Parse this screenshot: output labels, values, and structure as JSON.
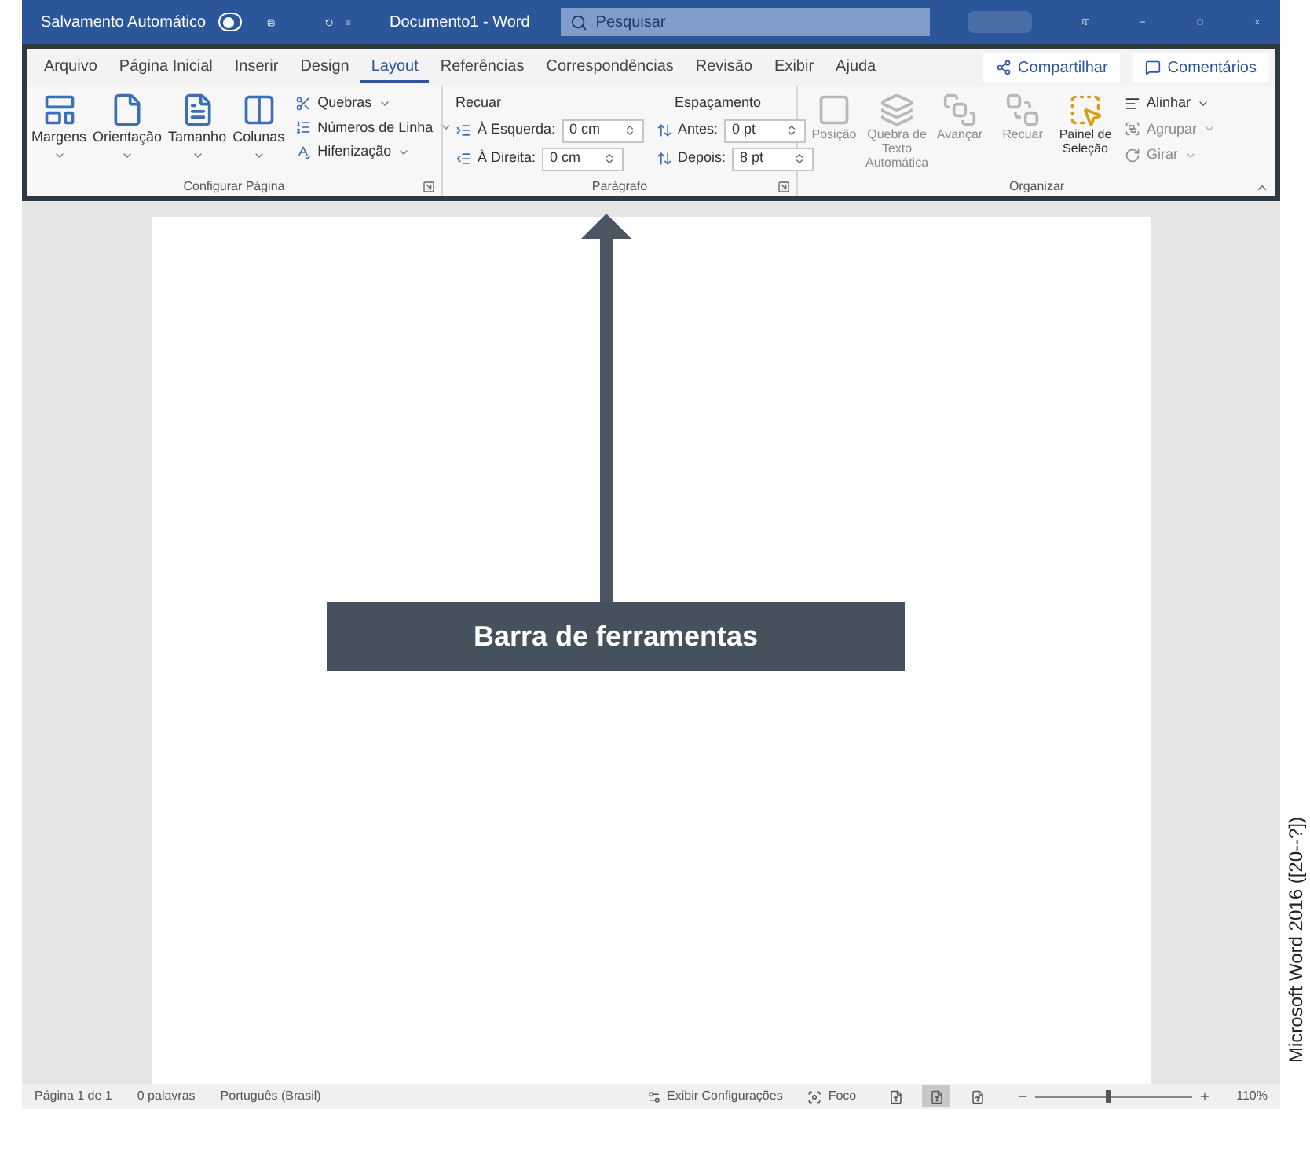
{
  "title_bar": {
    "autosave_label": "Salvamento Automático",
    "autosave_on": false,
    "document_title": "Documento1 - Word",
    "search_placeholder": "Pesquisar"
  },
  "ribbon_tabs": [
    {
      "label": "Arquivo",
      "selected": false
    },
    {
      "label": "Página Inicial",
      "selected": false
    },
    {
      "label": "Inserir",
      "selected": false
    },
    {
      "label": "Design",
      "selected": false
    },
    {
      "label": "Layout",
      "selected": true
    },
    {
      "label": "Referências",
      "selected": false
    },
    {
      "label": "Correspondências",
      "selected": false
    },
    {
      "label": "Revisão",
      "selected": false
    },
    {
      "label": "Exibir",
      "selected": false
    },
    {
      "label": "Ajuda",
      "selected": false
    }
  ],
  "share_button": "Compartilhar",
  "comments_button": "Comentários",
  "page_setup": {
    "title": "Configurar Página",
    "big_buttons": [
      {
        "label": "Margens",
        "kind": "margins"
      },
      {
        "label": "Orientação",
        "kind": "orientation"
      },
      {
        "label": "Tamanho",
        "kind": "size"
      },
      {
        "label": "Colunas",
        "kind": "columns"
      }
    ],
    "small_buttons": [
      "Quebras",
      "Números de Linha",
      "Hifenização"
    ]
  },
  "paragraph": {
    "title": "Parágrafo",
    "indent_heading": "Recuar",
    "indent_fields": [
      {
        "label": "À Esquerda:",
        "value": "0 cm"
      },
      {
        "label": "À Direita:",
        "value": "0 cm"
      }
    ],
    "spacing_heading": "Espaçamento",
    "spacing_fields": [
      {
        "label": "Antes:",
        "value": "0 pt"
      },
      {
        "label": "Depois:",
        "value": "8 pt"
      }
    ]
  },
  "arrange": {
    "title": "Organizar",
    "big_buttons": [
      {
        "label": "Posição",
        "disabled": true,
        "kind": "position"
      },
      {
        "label": "Quebra de Texto Automática",
        "disabled": true,
        "kind": "wrap"
      },
      {
        "label": "Avançar",
        "disabled": true,
        "kind": "forward"
      },
      {
        "label": "Recuar",
        "disabled": true,
        "kind": "backward"
      },
      {
        "label": "Painel de Seleção",
        "disabled": false,
        "kind": "pane"
      }
    ],
    "small_buttons": [
      {
        "label": "Alinhar",
        "disabled": false
      },
      {
        "label": "Agrupar",
        "disabled": true
      },
      {
        "label": "Girar",
        "disabled": true
      }
    ]
  },
  "annotation": {
    "label": "Barra de ferramentas"
  },
  "status_bar": {
    "page": "Página 1 de 1",
    "words": "0 palavras",
    "language": "Português (Brasil)",
    "display_settings": "Exibir Configurações",
    "focus": "Foco",
    "views": [
      {
        "selected": false
      },
      {
        "selected": true
      },
      {
        "selected": false
      }
    ],
    "zoom_slider": {
      "level": 0.45
    },
    "zoom": "110%"
  },
  "credit": "Microsoft Word 2016 ([20--?])"
}
